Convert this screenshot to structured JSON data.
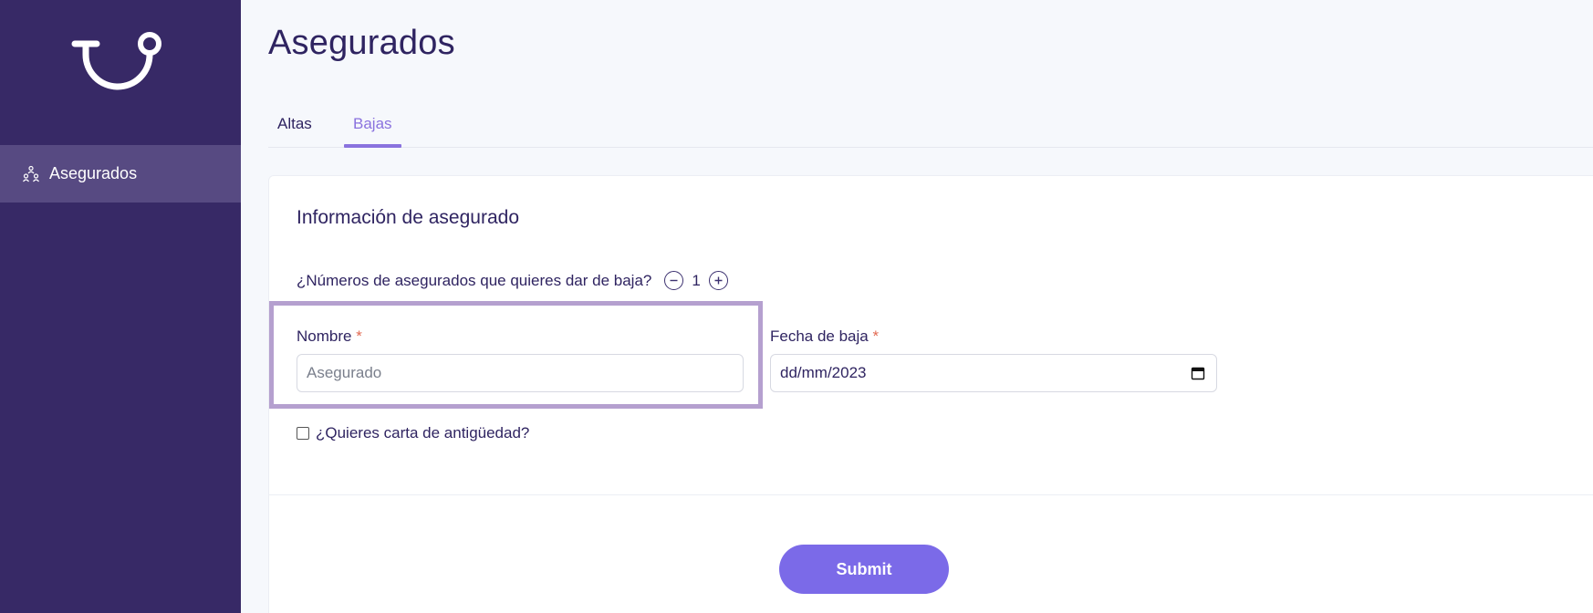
{
  "sidebar": {
    "logo_icon": "smile-logo-icon",
    "items": [
      {
        "label": "Asegurados",
        "icon": "people-icon",
        "active": true
      }
    ],
    "background": "#372966",
    "active_background": "#574a82"
  },
  "header": {
    "title": "Asegurados"
  },
  "tabs": [
    {
      "label": "Altas",
      "active": false
    },
    {
      "label": "Bajas",
      "active": true
    }
  ],
  "form": {
    "section_title": "Información de asegurado",
    "question": "¿Números de asegurados que quieres dar de baja?",
    "count": "1",
    "nombre": {
      "label": "Nombre",
      "required_mark": "*",
      "placeholder": "Asegurado",
      "value": ""
    },
    "fecha": {
      "label": "Fecha de baja",
      "required_mark": "*",
      "value": "dd/mm/2023"
    },
    "checkbox": {
      "label": "¿Quieres carta de antigüedad?",
      "checked": false
    },
    "submit_label": "Submit"
  },
  "colors": {
    "accent": "#8a72de",
    "button": "#7b6ae8",
    "text": "#2f2461",
    "required": "#e26a52",
    "highlight": "#b5a0cf"
  }
}
